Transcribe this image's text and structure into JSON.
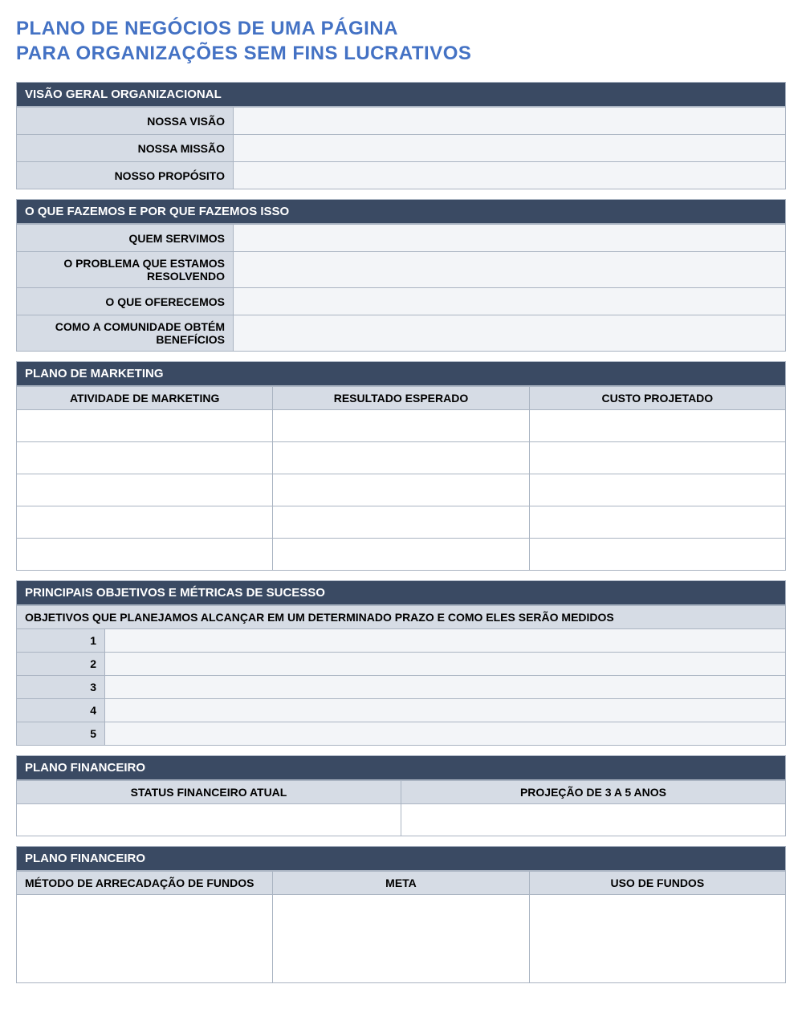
{
  "title_line1": "PLANO DE NEGÓCIOS DE UMA PÁGINA",
  "title_line2": "PARA ORGANIZAÇÕES SEM FINS LUCRATIVOS",
  "sections": {
    "org_overview": {
      "header": "VISÃO GERAL ORGANIZACIONAL",
      "rows": [
        {
          "label": "NOSSA VISÃO",
          "value": ""
        },
        {
          "label": "NOSSA MISSÃO",
          "value": ""
        },
        {
          "label": "NOSSO PROPÓSITO",
          "value": ""
        }
      ]
    },
    "what_we_do": {
      "header": "O QUE FAZEMOS E POR QUE FAZEMOS ISSO",
      "rows": [
        {
          "label": "QUEM SERVIMOS",
          "value": ""
        },
        {
          "label": "O PROBLEMA QUE ESTAMOS RESOLVENDO",
          "value": ""
        },
        {
          "label": "O QUE OFERECEMOS",
          "value": ""
        },
        {
          "label": "COMO A COMUNIDADE OBTÉM BENEFÍCIOS",
          "value": ""
        }
      ]
    },
    "marketing": {
      "header": "PLANO DE MARKETING",
      "columns": [
        "ATIVIDADE DE MARKETING",
        "RESULTADO ESPERADO",
        "CUSTO PROJETADO"
      ],
      "rows": [
        {
          "activity": "",
          "result": "",
          "cost": ""
        },
        {
          "activity": "",
          "result": "",
          "cost": ""
        },
        {
          "activity": "",
          "result": "",
          "cost": ""
        },
        {
          "activity": "",
          "result": "",
          "cost": ""
        },
        {
          "activity": "",
          "result": "",
          "cost": ""
        }
      ]
    },
    "objectives": {
      "header": "PRINCIPAIS OBJETIVOS E MÉTRICAS DE SUCESSO",
      "subheader": "OBJETIVOS QUE PLANEJAMOS ALCANÇAR EM UM DETERMINADO PRAZO E COMO ELES SERÃO MEDIDOS",
      "rows": [
        {
          "num": "1",
          "value": ""
        },
        {
          "num": "2",
          "value": ""
        },
        {
          "num": "3",
          "value": ""
        },
        {
          "num": "4",
          "value": ""
        },
        {
          "num": "5",
          "value": ""
        }
      ]
    },
    "financial": {
      "header": "PLANO FINANCEIRO",
      "columns": [
        "STATUS FINANCEIRO ATUAL",
        "PROJEÇÃO DE 3 A 5 ANOS"
      ],
      "row": {
        "status": "",
        "projection": ""
      }
    },
    "fundraising": {
      "header": "PLANO FINANCEIRO",
      "columns": [
        "MÉTODO DE ARRECADAÇÃO DE FUNDOS",
        "META",
        "USO DE FUNDOS"
      ],
      "row": {
        "method": "",
        "goal": "",
        "use": ""
      }
    }
  }
}
